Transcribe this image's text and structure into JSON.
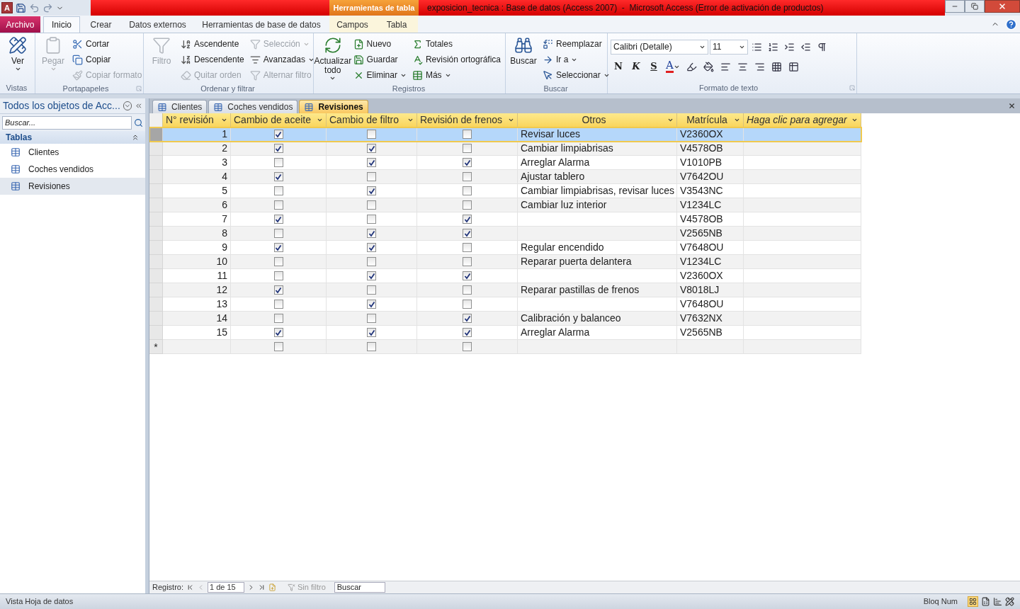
{
  "window": {
    "logo": "A",
    "title": "exposicion_tecnica : Base de datos (Access 2007)  -  Microsoft Access (Error de activación de productos)",
    "context_label": "Herramientas de tabla"
  },
  "tabs": [
    {
      "label": "Archivo",
      "kind": "file",
      "selected": false
    },
    {
      "label": "Inicio",
      "kind": "normal",
      "selected": true
    },
    {
      "label": "Crear",
      "kind": "normal",
      "selected": false
    },
    {
      "label": "Datos externos",
      "kind": "normal",
      "selected": false
    },
    {
      "label": "Herramientas de base de datos",
      "kind": "normal",
      "selected": false
    },
    {
      "label": "Campos",
      "kind": "context",
      "selected": false
    },
    {
      "label": "Tabla",
      "kind": "context",
      "selected": false
    }
  ],
  "ribbon": {
    "groups": [
      {
        "label": "Vistas",
        "launcher": false,
        "items": [
          {
            "label": "Ver",
            "kind": "large",
            "disabled": false,
            "dropdown": true
          }
        ]
      },
      {
        "label": "Portapapeles",
        "launcher": true,
        "items": [
          {
            "label": "Pegar",
            "kind": "large",
            "disabled": true,
            "dropdown": true
          },
          {
            "label": "Cortar",
            "kind": "small",
            "disabled": false,
            "dropdown": false
          },
          {
            "label": "Copiar",
            "kind": "small",
            "disabled": false,
            "dropdown": false
          },
          {
            "label": "Copiar formato",
            "kind": "small",
            "disabled": true,
            "dropdown": false
          }
        ]
      },
      {
        "label": "Ordenar y filtrar",
        "launcher": false,
        "items": [
          {
            "label": "Filtro",
            "kind": "large",
            "disabled": true,
            "dropdown": false
          },
          {
            "label": "Ascendente",
            "kind": "small",
            "disabled": false,
            "dropdown": false
          },
          {
            "label": "Descendente",
            "kind": "small",
            "disabled": false,
            "dropdown": false
          },
          {
            "label": "Quitar orden",
            "kind": "small",
            "disabled": true,
            "dropdown": false
          },
          {
            "label": "Selección",
            "kind": "small",
            "disabled": true,
            "dropdown": true
          },
          {
            "label": "Avanzadas",
            "kind": "small",
            "disabled": false,
            "dropdown": true
          },
          {
            "label": "Alternar filtro",
            "kind": "small",
            "disabled": true,
            "dropdown": false
          }
        ]
      },
      {
        "label": "Registros",
        "launcher": false,
        "items": [
          {
            "label": "Actualizar todo",
            "kind": "large",
            "disabled": false,
            "dropdown": true
          },
          {
            "label": "Nuevo",
            "kind": "small",
            "disabled": false,
            "dropdown": false
          },
          {
            "label": "Guardar",
            "kind": "small",
            "disabled": false,
            "dropdown": false
          },
          {
            "label": "Eliminar",
            "kind": "small",
            "disabled": false,
            "dropdown": true
          },
          {
            "label": "Totales",
            "kind": "small",
            "disabled": false,
            "dropdown": false
          },
          {
            "label": "Revisión ortográfica",
            "kind": "small",
            "disabled": false,
            "dropdown": false
          },
          {
            "label": "Más",
            "kind": "small",
            "disabled": false,
            "dropdown": true
          }
        ]
      },
      {
        "label": "Buscar",
        "launcher": false,
        "items": [
          {
            "label": "Buscar",
            "kind": "large",
            "disabled": false,
            "dropdown": false
          },
          {
            "label": "Reemplazar",
            "kind": "small",
            "disabled": false,
            "dropdown": false
          },
          {
            "label": "Ir a",
            "kind": "small",
            "disabled": false,
            "dropdown": true
          },
          {
            "label": "Seleccionar",
            "kind": "small",
            "disabled": false,
            "dropdown": true
          }
        ]
      }
    ],
    "format_group": {
      "label": "Formato de texto",
      "font": "Calibri (Detalle)",
      "size": "11",
      "bold": "N",
      "italic": "K",
      "underline": "S",
      "font_color": "A"
    }
  },
  "nav_pane": {
    "title": "Todos los objetos de Acc...",
    "search_placeholder": "Buscar...",
    "section": "Tablas",
    "items": [
      {
        "label": "Clientes",
        "selected": false
      },
      {
        "label": "Coches vendidos",
        "selected": false
      },
      {
        "label": "Revisiones",
        "selected": true
      }
    ]
  },
  "doc_tabs": [
    {
      "label": "Clientes",
      "selected": false
    },
    {
      "label": "Coches vendidos",
      "selected": false
    },
    {
      "label": "Revisiones",
      "selected": true
    }
  ],
  "table": {
    "columns": [
      {
        "label": "N° revisión",
        "kind": "number"
      },
      {
        "label": "Cambio de aceite",
        "kind": "aceite"
      },
      {
        "label": "Cambio de filtro",
        "kind": "filtro"
      },
      {
        "label": "Revisión de frenos",
        "kind": "frenos"
      },
      {
        "label": "Otros",
        "kind": "otros"
      },
      {
        "label": "Matrícula",
        "kind": "matricula"
      },
      {
        "label": "Haga clic para agregar",
        "kind": "add"
      }
    ],
    "rows": [
      {
        "selected": true,
        "number": "1",
        "aceite": true,
        "filtro": false,
        "frenos": false,
        "otros": "Revisar luces",
        "matricula": "V2360OX"
      },
      {
        "selected": false,
        "number": "2",
        "aceite": true,
        "filtro": true,
        "frenos": false,
        "otros": "Cambiar limpiabrisas",
        "matricula": "V4578OB"
      },
      {
        "selected": false,
        "number": "3",
        "aceite": false,
        "filtro": true,
        "frenos": true,
        "otros": "Arreglar Alarma",
        "matricula": "V1010PB"
      },
      {
        "selected": false,
        "number": "4",
        "aceite": true,
        "filtro": false,
        "frenos": false,
        "otros": "Ajustar tablero",
        "matricula": "V7642OU"
      },
      {
        "selected": false,
        "number": "5",
        "aceite": false,
        "filtro": true,
        "frenos": false,
        "otros": "Cambiar limpiabrisas, revisar luces",
        "matricula": "V3543NC"
      },
      {
        "selected": false,
        "number": "6",
        "aceite": false,
        "filtro": false,
        "frenos": false,
        "otros": "Cambiar luz interior",
        "matricula": "V1234LC"
      },
      {
        "selected": false,
        "number": "7",
        "aceite": true,
        "filtro": false,
        "frenos": true,
        "matricula": "V4578OB"
      },
      {
        "selected": false,
        "number": "8",
        "aceite": false,
        "filtro": true,
        "frenos": true,
        "matricula": "V2565NB"
      },
      {
        "selected": false,
        "number": "9",
        "aceite": true,
        "filtro": true,
        "frenos": false,
        "otros": "Regular encendido",
        "matricula": "V7648OU"
      },
      {
        "selected": false,
        "number": "10",
        "aceite": false,
        "filtro": false,
        "frenos": false,
        "otros": "Reparar puerta delantera",
        "matricula": "V1234LC"
      },
      {
        "selected": false,
        "number": "11",
        "aceite": false,
        "filtro": true,
        "frenos": true,
        "matricula": "V2360OX"
      },
      {
        "selected": false,
        "number": "12",
        "aceite": true,
        "filtro": false,
        "frenos": false,
        "otros": "Reparar pastillas de frenos",
        "matricula": "V8018LJ"
      },
      {
        "selected": false,
        "number": "13",
        "aceite": false,
        "filtro": true,
        "frenos": false,
        "matricula": "V7648OU"
      },
      {
        "selected": false,
        "number": "14",
        "aceite": false,
        "filtro": false,
        "frenos": true,
        "otros": "Calibración y balanceo",
        "matricula": "V7632NX"
      },
      {
        "selected": false,
        "number": "15",
        "aceite": true,
        "filtro": true,
        "frenos": true,
        "otros": "Arreglar Alarma",
        "matricula": "V2565NB"
      }
    ],
    "new_row": {
      "marker": "*",
      "aceite": false,
      "filtro": false,
      "frenos": false
    }
  },
  "record_nav": {
    "label": "Registro:",
    "position": "1 de 15",
    "filter": "Sin filtro",
    "filter_disabled": true,
    "search_placeholder": "Buscar"
  },
  "status_bar": {
    "view": "Vista Hoja de datos",
    "num_lock": "Bloq Num"
  }
}
